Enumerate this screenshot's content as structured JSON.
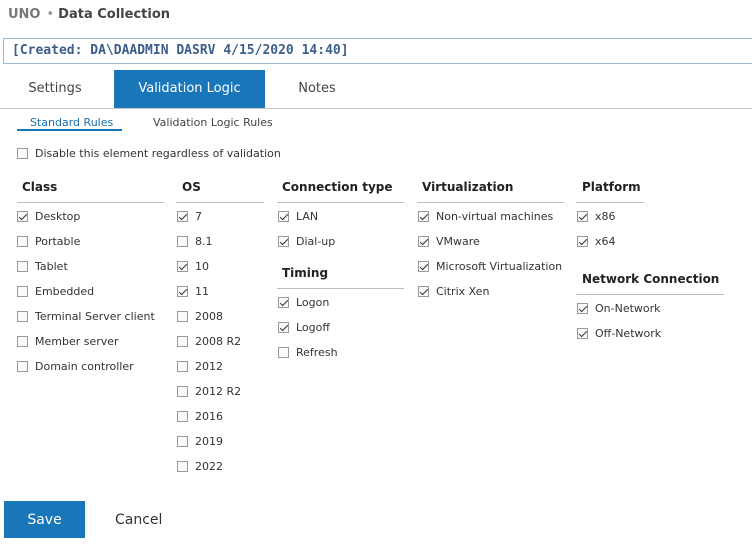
{
  "titlebar": {
    "app": "UNO",
    "separator": "•",
    "page": "Data Collection"
  },
  "created": "[Created: DA\\DAADMIN DASRV 4/15/2020 14:40]",
  "tabs": [
    {
      "label": "Settings",
      "active": false
    },
    {
      "label": "Validation Logic",
      "active": true
    },
    {
      "label": "Notes",
      "active": false
    }
  ],
  "subtabs": [
    {
      "label": "Standard Rules",
      "active": true
    },
    {
      "label": "Validation Logic Rules",
      "active": false
    }
  ],
  "disable": {
    "label": "Disable this element regardless of validation",
    "checked": false
  },
  "columns": {
    "class": {
      "title": "Class",
      "items": [
        {
          "label": "Desktop",
          "checked": true
        },
        {
          "label": "Portable",
          "checked": false
        },
        {
          "label": "Tablet",
          "checked": false
        },
        {
          "label": "Embedded",
          "checked": false
        },
        {
          "label": "Terminal Server client",
          "checked": false
        },
        {
          "label": "Member server",
          "checked": false
        },
        {
          "label": "Domain controller",
          "checked": false
        }
      ]
    },
    "os": {
      "title": "OS",
      "items": [
        {
          "label": "7",
          "checked": true
        },
        {
          "label": "8.1",
          "checked": false
        },
        {
          "label": "10",
          "checked": true
        },
        {
          "label": "11",
          "checked": true
        },
        {
          "label": "2008",
          "checked": false
        },
        {
          "label": "2008 R2",
          "checked": false
        },
        {
          "label": "2012",
          "checked": false
        },
        {
          "label": "2012 R2",
          "checked": false
        },
        {
          "label": "2016",
          "checked": false
        },
        {
          "label": "2019",
          "checked": false
        },
        {
          "label": "2022",
          "checked": false
        }
      ]
    },
    "connection": {
      "title": "Connection type",
      "items": [
        {
          "label": "LAN",
          "checked": true
        },
        {
          "label": "Dial-up",
          "checked": true
        }
      ]
    },
    "timing": {
      "title": "Timing",
      "items": [
        {
          "label": "Logon",
          "checked": true
        },
        {
          "label": "Logoff",
          "checked": true
        },
        {
          "label": "Refresh",
          "checked": false
        }
      ]
    },
    "virtualization": {
      "title": "Virtualization",
      "items": [
        {
          "label": "Non-virtual machines",
          "checked": true
        },
        {
          "label": "VMware",
          "checked": true
        },
        {
          "label": "Microsoft Virtualization",
          "checked": true
        },
        {
          "label": "Citrix Xen",
          "checked": true
        }
      ]
    },
    "platform": {
      "title": "Platform",
      "items": [
        {
          "label": "x86",
          "checked": true
        },
        {
          "label": "x64",
          "checked": true
        }
      ]
    },
    "network": {
      "title": "Network Connection",
      "items": [
        {
          "label": "On-Network",
          "checked": true
        },
        {
          "label": "Off-Network",
          "checked": true
        }
      ]
    }
  },
  "buttons": {
    "save": "Save",
    "cancel": "Cancel"
  },
  "colors": {
    "accent": "#1976b8",
    "created_text": "#3b5f8a"
  }
}
